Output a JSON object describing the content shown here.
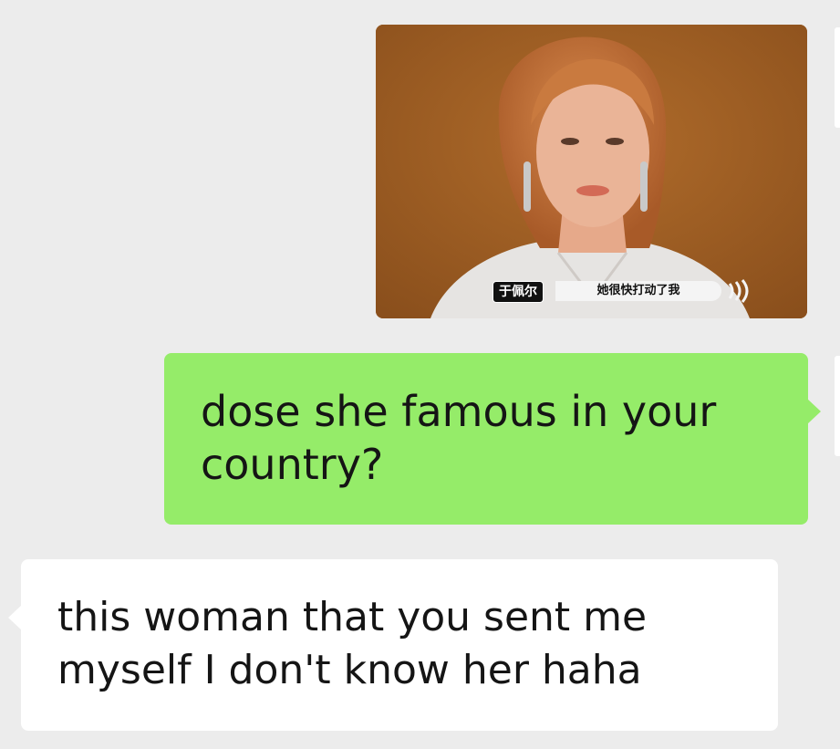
{
  "chat": {
    "messages": [
      {
        "type": "image",
        "direction": "sent",
        "image_caption": {
          "name_tag": "于佩尔",
          "subtitle": "她很快打动了我"
        }
      },
      {
        "type": "text",
        "direction": "sent",
        "text": "dose she famous in your country?"
      },
      {
        "type": "text",
        "direction": "received",
        "text": "this woman that you sent me myself I don't know her haha"
      }
    ]
  },
  "colors": {
    "background": "#ececec",
    "sent_bubble": "#95ec69",
    "received_bubble": "#ffffff",
    "text": "#151515"
  }
}
